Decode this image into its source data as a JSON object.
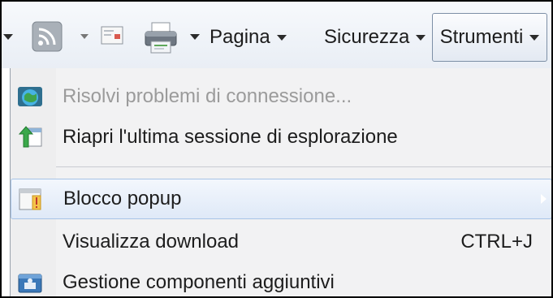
{
  "toolbar": {
    "feeds_icon": "rss-feed-icon",
    "read_mail_icon": "read-mail-icon",
    "print_icon": "printer-icon",
    "page_label": "Pagina",
    "security_label": "Sicurezza",
    "tools_label": "Strumenti"
  },
  "menu": {
    "items": [
      {
        "label": "Risolvi problemi di connessione...",
        "icon": "network-diagnostics-icon",
        "enabled": false
      },
      {
        "label": "Riapri l'ultima sessione di esplorazione",
        "icon": "reopen-session-icon"
      },
      {
        "label": "Blocco popup",
        "icon": "popup-blocker-icon",
        "has_submenu": true
      },
      {
        "label": "Visualizza download",
        "shortcut": "CTRL+J"
      },
      {
        "label": "Gestione componenti aggiuntivi",
        "icon": "addons-icon"
      }
    ]
  }
}
